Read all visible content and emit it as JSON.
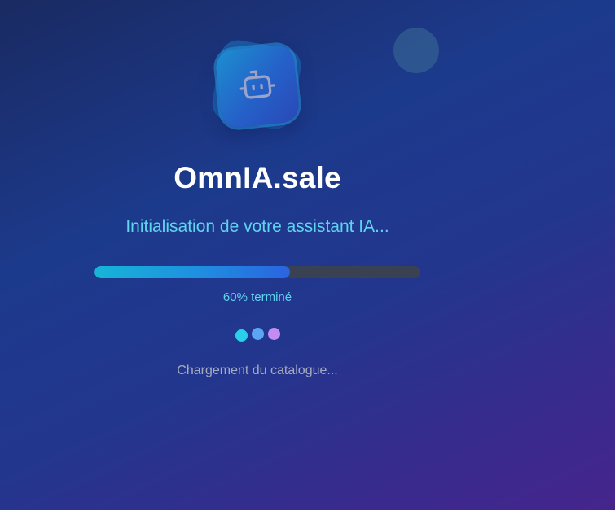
{
  "app": {
    "title": "OmnIA.sale",
    "subtitle": "Initialisation de votre assistant IA...",
    "logo_icon": "robot-icon"
  },
  "progress": {
    "value": 0.6,
    "label": "60% terminé"
  },
  "loading": {
    "status_text": "Chargement du catalogue...",
    "dots": [
      "#2ad0ea",
      "#5aa6f4",
      "#c38cf2"
    ]
  },
  "colors": {
    "accent": "#5fd4ee",
    "progress_track": "#3a4152"
  }
}
